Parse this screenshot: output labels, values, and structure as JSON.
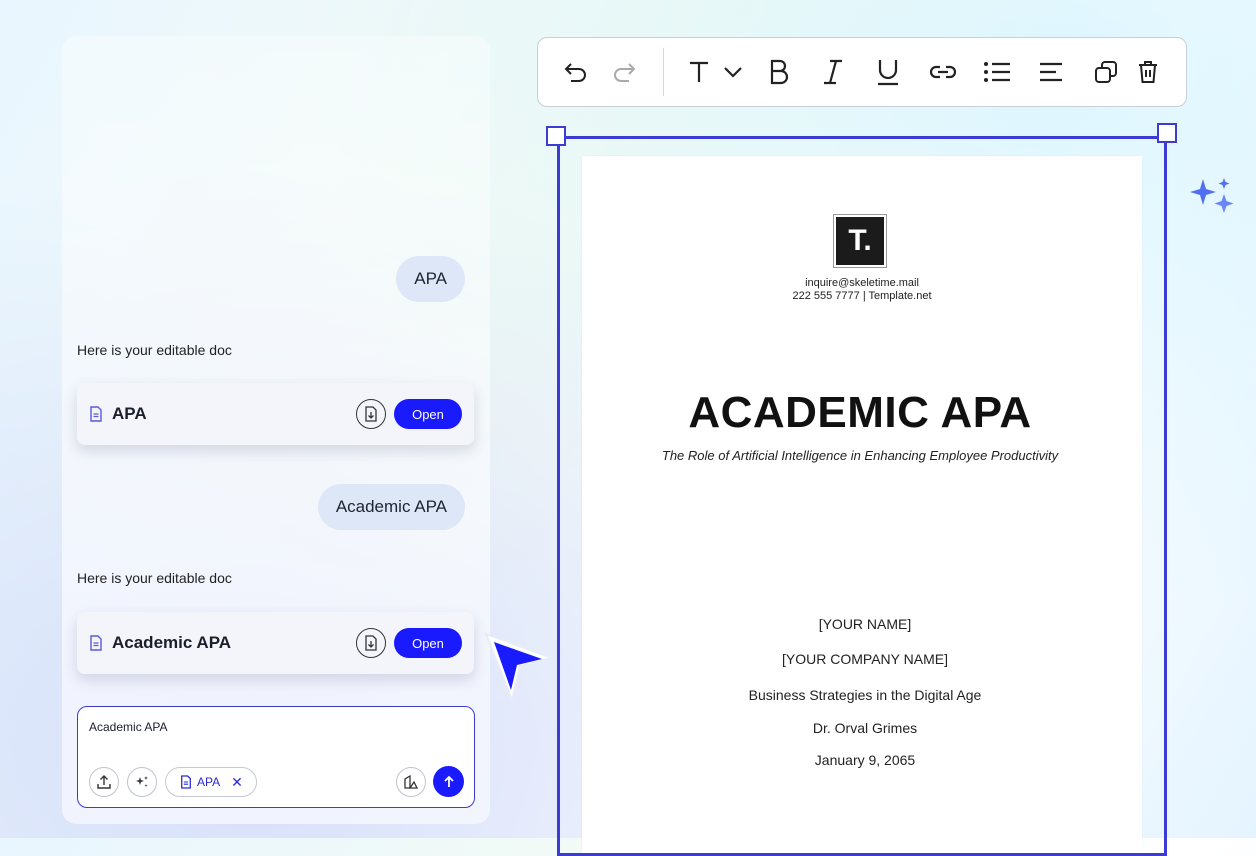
{
  "chat": {
    "messages": [
      {
        "role": "user",
        "text": "APA"
      },
      {
        "role": "assistant",
        "text": "Here is your editable doc",
        "doc_name": "APA",
        "open_label": "Open"
      },
      {
        "role": "user",
        "text": "Academic APA"
      },
      {
        "role": "assistant",
        "text": "Here is your editable doc",
        "doc_name": "Academic APA",
        "open_label": "Open"
      }
    ],
    "composer": {
      "value": "Academic APA",
      "attachment_chip": "APA"
    }
  },
  "toolbar": {
    "icons": [
      "undo-icon",
      "redo-icon",
      "text-type-icon",
      "chevron-down-icon",
      "bold-icon",
      "italic-icon",
      "underline-icon",
      "link-icon",
      "bulleted-list-icon",
      "align-left-icon",
      "duplicate-icon",
      "delete-icon"
    ]
  },
  "document": {
    "logo_letter": "T.",
    "email": "inquire@skeletime.mail",
    "phone_line": "222 555 7777 | Template.net",
    "title": "ACADEMIC APA",
    "subtitle": "The Role of Artificial Intelligence in Enhancing Employee Productivity",
    "your_name": "[YOUR NAME]",
    "company_name": "[YOUR COMPANY NAME]",
    "course": "Business Strategies in the Digital Age",
    "instructor": "Dr. Orval Grimes",
    "date": "January 9, 2065"
  },
  "colors": {
    "accent": "#1a1aff",
    "selection": "#3c3cd4",
    "bubble": "#dde7f7"
  }
}
